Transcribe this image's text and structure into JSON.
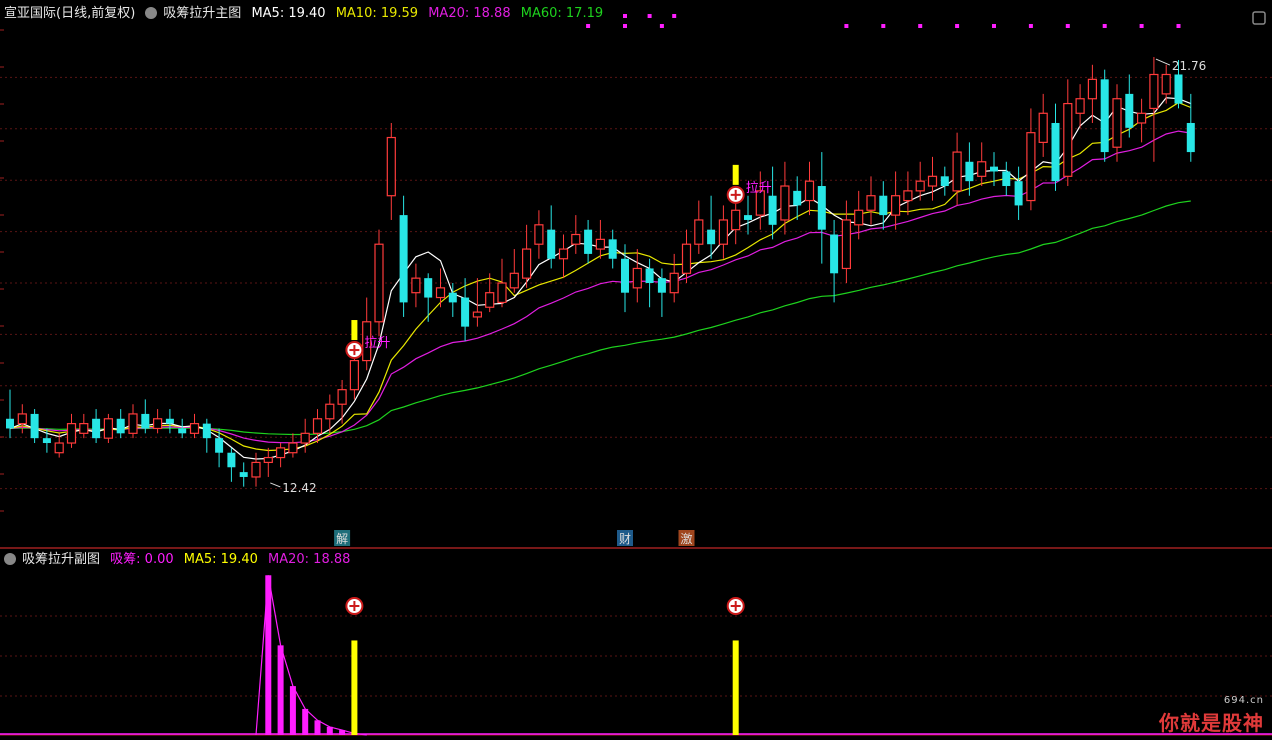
{
  "main_header": {
    "stock": "宣亚国际(日线,前复权)",
    "indicator_name": "吸筹拉升主图",
    "ma5": "MA5: 19.40",
    "ma10": "MA10: 19.59",
    "ma20": "MA20: 18.88",
    "ma60": "MA60: 17.19"
  },
  "sub_header": {
    "indicator_name": "吸筹拉升副图",
    "xichou": "吸筹: 0.00",
    "ma5": "MA5: 19.40",
    "ma20": "MA20: 18.88"
  },
  "watermark": {
    "text": "你就是股神",
    "site": "694.cn"
  },
  "colors": {
    "up": "#ff3b3b",
    "down": "#28e6e6",
    "ma5": "#ffffff",
    "ma10": "#e8e800",
    "ma20": "#e01ee0",
    "ma60": "#1ed21e",
    "magenta": "#ff1eff",
    "yellow": "#ffff00"
  },
  "chart_data": [
    {
      "type": "candlestick",
      "ylim": [
        11.8,
        22.4
      ],
      "annotations": {
        "high_label": "21.76",
        "low_label": "12.42",
        "signal_label": "拉升",
        "event_jie": "解",
        "event_cai": "财",
        "event_ji": "激"
      },
      "high_index": 93,
      "low_index": 21,
      "signal_indices": [
        28,
        59
      ],
      "event_indices": {
        "jie": 27,
        "cai": 50,
        "ji": 55
      },
      "candles": [
        [
          14.3,
          14.1,
          14.9,
          13.9
        ],
        [
          14.2,
          14.4,
          14.6,
          14.0
        ],
        [
          14.4,
          13.9,
          14.5,
          13.8
        ],
        [
          13.9,
          13.8,
          14.1,
          13.6
        ],
        [
          13.6,
          13.8,
          14.0,
          13.5
        ],
        [
          13.8,
          14.2,
          14.4,
          13.7
        ],
        [
          14.0,
          14.2,
          14.4,
          13.9
        ],
        [
          14.3,
          13.9,
          14.5,
          13.8
        ],
        [
          13.9,
          14.3,
          14.4,
          13.8
        ],
        [
          14.3,
          14.0,
          14.5,
          13.9
        ],
        [
          14.0,
          14.4,
          14.6,
          13.9
        ],
        [
          14.4,
          14.1,
          14.7,
          14.0
        ],
        [
          14.1,
          14.3,
          14.5,
          14.0
        ],
        [
          14.3,
          14.2,
          14.5,
          14.0
        ],
        [
          14.1,
          14.0,
          14.3,
          13.9
        ],
        [
          14.0,
          14.2,
          14.4,
          13.9
        ],
        [
          14.2,
          13.9,
          14.3,
          13.6
        ],
        [
          13.9,
          13.6,
          14.1,
          13.3
        ],
        [
          13.6,
          13.3,
          13.7,
          13.0
        ],
        [
          13.2,
          13.1,
          13.4,
          12.9
        ],
        [
          13.1,
          13.4,
          13.6,
          12.9
        ],
        [
          13.4,
          13.5,
          13.7,
          13.1
        ],
        [
          13.5,
          13.7,
          13.8,
          13.3
        ],
        [
          13.6,
          13.8,
          14.0,
          13.5
        ],
        [
          13.8,
          14.0,
          14.3,
          13.6
        ],
        [
          14.0,
          14.3,
          14.5,
          13.8
        ],
        [
          14.3,
          14.6,
          14.8,
          14.0
        ],
        [
          14.6,
          14.9,
          15.1,
          14.2
        ],
        [
          14.9,
          15.5,
          15.8,
          14.7
        ],
        [
          15.5,
          16.3,
          16.8,
          15.3
        ],
        [
          16.3,
          17.9,
          18.2,
          16.0
        ],
        [
          18.9,
          20.1,
          20.4,
          18.4
        ],
        [
          18.5,
          16.7,
          18.9,
          16.4
        ],
        [
          16.9,
          17.2,
          17.5,
          16.6
        ],
        [
          17.2,
          16.8,
          17.3,
          16.3
        ],
        [
          16.8,
          17.0,
          17.4,
          16.6
        ],
        [
          16.9,
          16.7,
          17.1,
          16.4
        ],
        [
          16.8,
          16.2,
          17.2,
          15.9
        ],
        [
          16.4,
          16.5,
          17.2,
          16.2
        ],
        [
          16.6,
          16.9,
          17.3,
          16.5
        ],
        [
          16.7,
          17.1,
          17.6,
          16.6
        ],
        [
          17.0,
          17.3,
          17.8,
          16.9
        ],
        [
          17.2,
          17.8,
          18.3,
          17.0
        ],
        [
          17.9,
          18.3,
          18.6,
          17.6
        ],
        [
          18.2,
          17.6,
          18.7,
          17.4
        ],
        [
          17.6,
          17.8,
          18.1,
          17.2
        ],
        [
          17.9,
          18.1,
          18.5,
          17.7
        ],
        [
          18.2,
          17.7,
          18.4,
          17.5
        ],
        [
          17.8,
          18.0,
          18.4,
          17.6
        ],
        [
          18.0,
          17.6,
          18.2,
          17.4
        ],
        [
          17.6,
          16.9,
          17.9,
          16.5
        ],
        [
          17.0,
          17.4,
          17.8,
          16.7
        ],
        [
          17.4,
          17.1,
          17.6,
          16.6
        ],
        [
          17.2,
          16.9,
          17.4,
          16.4
        ],
        [
          16.9,
          17.3,
          17.7,
          16.7
        ],
        [
          17.3,
          17.9,
          18.2,
          17.1
        ],
        [
          17.9,
          18.4,
          18.8,
          17.7
        ],
        [
          18.2,
          17.9,
          18.9,
          17.6
        ],
        [
          17.9,
          18.4,
          18.7,
          17.6
        ],
        [
          18.2,
          18.6,
          19.0,
          17.9
        ],
        [
          18.5,
          18.4,
          18.9,
          18.1
        ],
        [
          18.5,
          19.0,
          19.4,
          18.2
        ],
        [
          18.9,
          18.3,
          19.5,
          18.0
        ],
        [
          18.4,
          19.1,
          19.6,
          18.1
        ],
        [
          19.0,
          18.7,
          19.3,
          18.4
        ],
        [
          18.8,
          19.2,
          19.6,
          18.5
        ],
        [
          19.1,
          18.2,
          19.8,
          17.5
        ],
        [
          18.1,
          17.3,
          18.4,
          16.7
        ],
        [
          17.4,
          18.4,
          18.8,
          17.1
        ],
        [
          18.3,
          18.6,
          19.0,
          18.0
        ],
        [
          18.6,
          18.9,
          19.3,
          18.3
        ],
        [
          18.9,
          18.5,
          19.2,
          18.2
        ],
        [
          18.5,
          18.9,
          19.4,
          18.2
        ],
        [
          18.8,
          19.0,
          19.4,
          18.5
        ],
        [
          19.0,
          19.2,
          19.6,
          18.8
        ],
        [
          19.1,
          19.3,
          19.7,
          18.8
        ],
        [
          19.3,
          19.1,
          19.5,
          18.9
        ],
        [
          19.0,
          19.8,
          20.2,
          18.7
        ],
        [
          19.6,
          19.2,
          20.0,
          18.9
        ],
        [
          19.3,
          19.6,
          20.0,
          19.1
        ],
        [
          19.5,
          19.4,
          19.8,
          19.1
        ],
        [
          19.4,
          19.1,
          19.6,
          18.9
        ],
        [
          19.2,
          18.7,
          19.5,
          18.4
        ],
        [
          18.8,
          20.2,
          20.7,
          18.6
        ],
        [
          20.0,
          20.6,
          21.0,
          19.7
        ],
        [
          20.4,
          19.2,
          20.8,
          19.0
        ],
        [
          19.3,
          20.8,
          21.3,
          19.1
        ],
        [
          20.6,
          20.9,
          21.2,
          20.3
        ],
        [
          20.9,
          21.3,
          21.6,
          20.4
        ],
        [
          21.3,
          19.8,
          21.5,
          19.6
        ],
        [
          19.9,
          20.9,
          21.2,
          19.6
        ],
        [
          21.0,
          20.3,
          21.4,
          20.1
        ],
        [
          20.4,
          20.6,
          20.9,
          20.0
        ],
        [
          20.7,
          21.4,
          21.76,
          19.6
        ],
        [
          21.0,
          21.4,
          21.6,
          20.8
        ],
        [
          21.4,
          20.8,
          21.7,
          20.7
        ],
        [
          20.4,
          19.8,
          21.0,
          19.6
        ]
      ],
      "ma5_segment": {
        "start": 26
      },
      "ma10_segment": {
        "start": 29
      }
    },
    {
      "type": "bar",
      "ylim": [
        0,
        100
      ],
      "magenta_bars": [
        [
          20,
          0
        ],
        [
          21,
          98
        ],
        [
          22,
          55
        ],
        [
          23,
          30
        ],
        [
          24,
          16
        ],
        [
          25,
          9
        ],
        [
          26,
          5
        ],
        [
          27,
          3
        ],
        [
          28,
          1
        ],
        [
          29,
          0
        ]
      ],
      "yellow_bars": [
        [
          28,
          58
        ],
        [
          59,
          58
        ]
      ],
      "plus_markers": [
        28,
        59
      ]
    }
  ]
}
